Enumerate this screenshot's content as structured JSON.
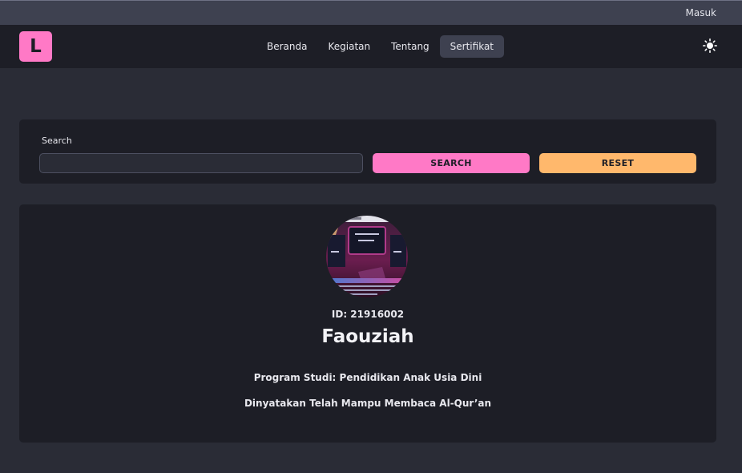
{
  "topbar": {
    "login_label": "Masuk"
  },
  "navbar": {
    "logo_letter": "L",
    "menu": [
      {
        "label": "Beranda"
      },
      {
        "label": "Kegiatan"
      },
      {
        "label": "Tentang"
      },
      {
        "label": "Sertifikat",
        "active": true
      }
    ],
    "theme_icon": "sun-icon"
  },
  "search": {
    "label": "Search",
    "value": "",
    "search_button": "SEARCH",
    "reset_button": "RESET"
  },
  "result": {
    "photo_icon": "profile-photo",
    "id_text": "ID: 21916002",
    "name": "Faouziah",
    "program": "Program Studi: Pendidikan Anak Usia Dini",
    "statement": "Dinyatakan Telah Mampu Membaca Al-Qur’an"
  },
  "colors": {
    "accent_pink": "#ff79c6",
    "accent_orange": "#ffb86c",
    "surface": "#1d1e26",
    "background": "#2a2c36"
  }
}
